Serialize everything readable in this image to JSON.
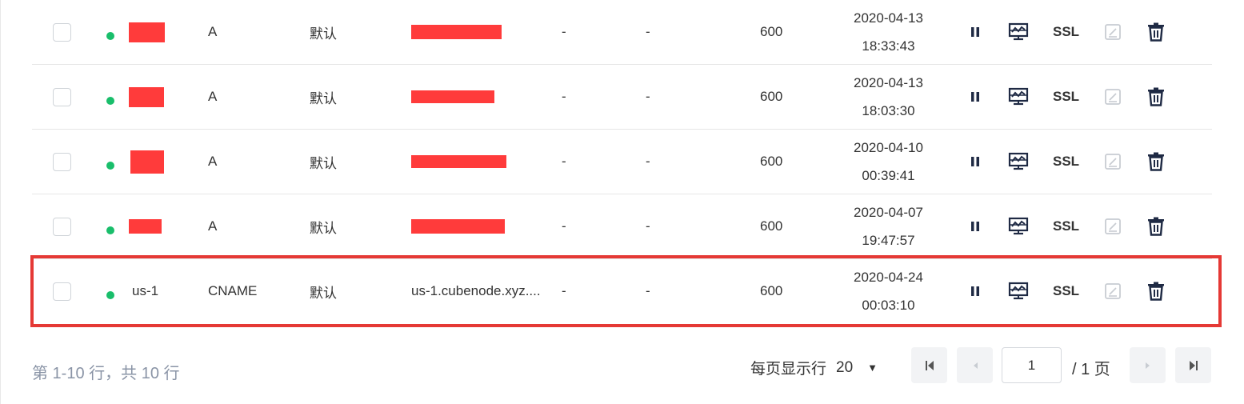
{
  "rows": [
    {
      "name": "",
      "type": "A",
      "line": "默认",
      "value": "",
      "mx": "-",
      "weight": "-",
      "ttl": "600",
      "date": "2020-04-13",
      "time": "18:33:43"
    },
    {
      "name": "",
      "type": "A",
      "line": "默认",
      "value": "",
      "mx": "-",
      "weight": "-",
      "ttl": "600",
      "date": "2020-04-13",
      "time": "18:03:30"
    },
    {
      "name": "",
      "type": "A",
      "line": "默认",
      "value": "",
      "mx": "-",
      "weight": "-",
      "ttl": "600",
      "date": "2020-04-10",
      "time": "00:39:41"
    },
    {
      "name": "",
      "type": "A",
      "line": "默认",
      "value": "",
      "mx": "-",
      "weight": "-",
      "ttl": "600",
      "date": "2020-04-07",
      "time": "19:47:57"
    },
    {
      "name": "us-1",
      "type": "CNAME",
      "line": "默认",
      "value": "us-1.cubenode.xyz....",
      "mx": "-",
      "weight": "-",
      "ttl": "600",
      "date": "2020-04-24",
      "time": "00:03:10"
    }
  ],
  "actions": {
    "ssl_label": "SSL"
  },
  "pagination": {
    "summary": "第 1-10 行，共 10 行",
    "per_page_label": "每页显示行",
    "per_page_value": "20",
    "current_page": "1",
    "total_pages": "/ 1 页"
  },
  "colors": {
    "status_green": "#19be6b",
    "highlight_red": "#e53935",
    "redaction": "#ff3b3b",
    "icon_dark": "#1f2a44"
  }
}
